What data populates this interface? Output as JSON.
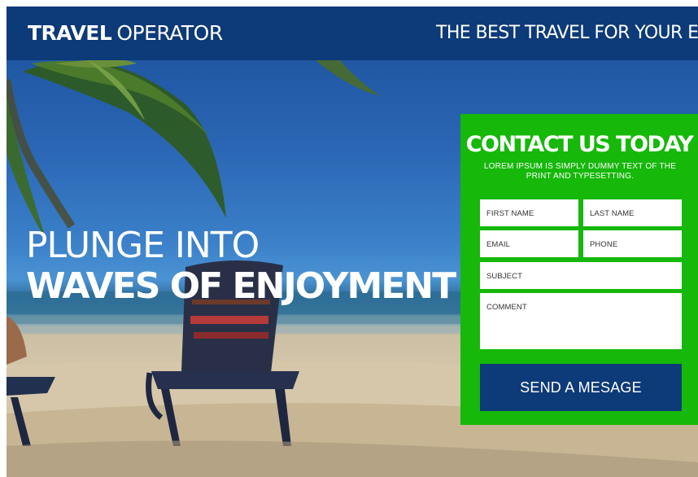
{
  "header": {
    "logo_strong": "TRAVEL",
    "logo_light": "OPERATOR",
    "tagline": "THE BEST TRAVEL FOR YOUR ENJOY"
  },
  "hero": {
    "line1": "PLUNGE INTO",
    "line2": "WAVES OF ENJOYMENT"
  },
  "contact": {
    "title": "CONTACT US TODAY",
    "subtitle": "LOREM IPSUM IS SIMPLY DUMMY TEXT OF THE PRINT AND TYPESETTING.",
    "fields": {
      "first_name": "FIRST NAME",
      "last_name": "LAST NAME",
      "email": "EMAIL",
      "phone": "PHONE",
      "subject": "SUBJECT",
      "comment": "COMMENT"
    },
    "submit_label": "SEND A MESAGE"
  },
  "colors": {
    "header_bg": "#0d3a78",
    "panel_bg": "#16b80a",
    "button_bg": "#0d3a78"
  }
}
